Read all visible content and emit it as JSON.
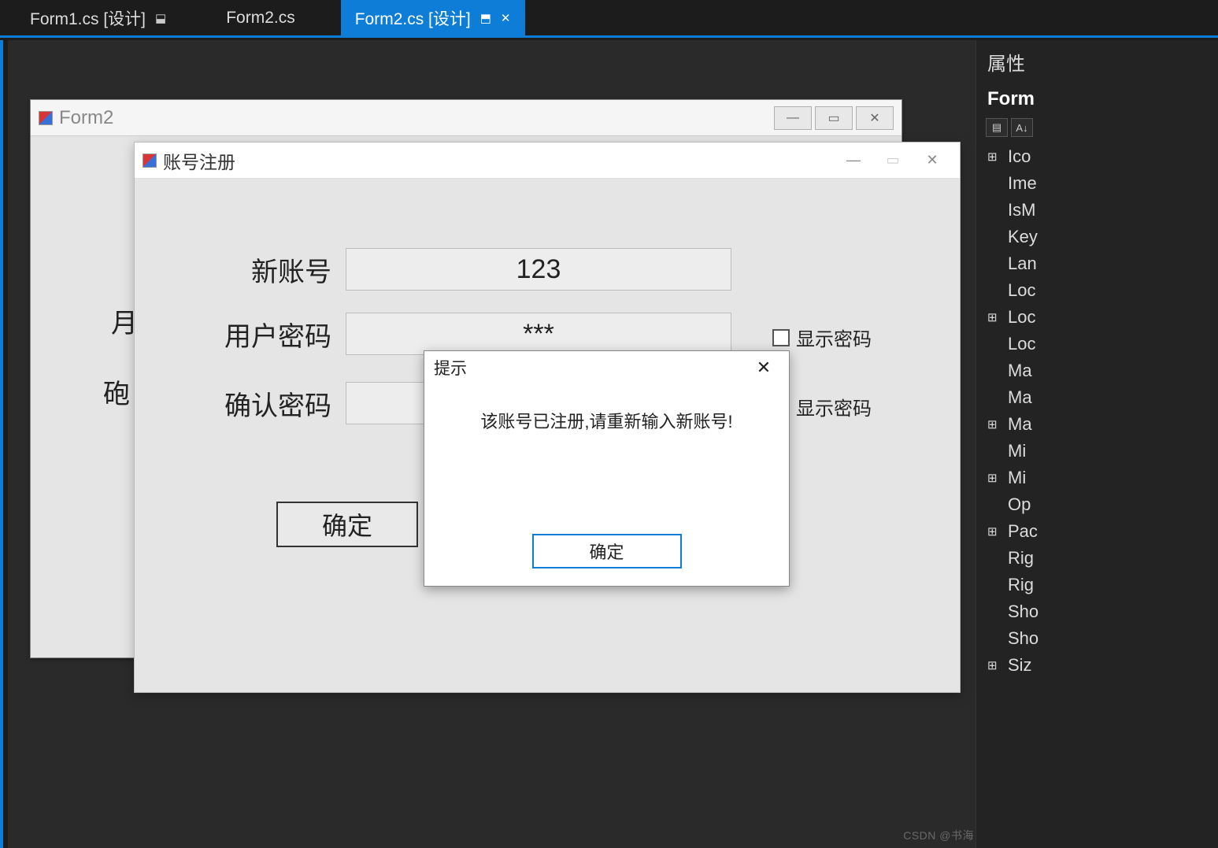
{
  "tabs": [
    {
      "label": "Form1.cs [设计]",
      "pinned": true,
      "active": false
    },
    {
      "label": "Form2.cs",
      "active": false
    },
    {
      "label": "Form2.cs [设计]",
      "pinned": true,
      "active": true,
      "closable": true
    }
  ],
  "designer": {
    "form2": {
      "title": "Form2",
      "bg_labels": {
        "user": "月",
        "confirm": "砲"
      }
    }
  },
  "registration": {
    "title": "账号注册",
    "fields": {
      "account": {
        "label": "新账号",
        "value": "123"
      },
      "password": {
        "label": "用户密码",
        "value": "***"
      },
      "confirm": {
        "label": "确认密码",
        "value": ""
      }
    },
    "show_password_label": "显示密码",
    "submit_label": "确定"
  },
  "messagebox": {
    "title": "提示",
    "body": "该账号已注册,请重新输入新账号!",
    "ok_label": "确定"
  },
  "properties_panel": {
    "title": "属性",
    "object_label": "Form",
    "items": [
      "Ico",
      "Ime",
      "IsM",
      "Key",
      "Lan",
      "Loc",
      "Loc",
      "Loc",
      "Ma",
      "Ma",
      "Ma",
      "Mi",
      "Mi",
      "Op",
      "Pac",
      "Rig",
      "Rig",
      "Sho",
      "Sho",
      "Siz"
    ],
    "expandable_indexes": [
      0,
      6,
      10,
      12,
      14,
      19
    ]
  },
  "watermark": "CSDN @书海"
}
